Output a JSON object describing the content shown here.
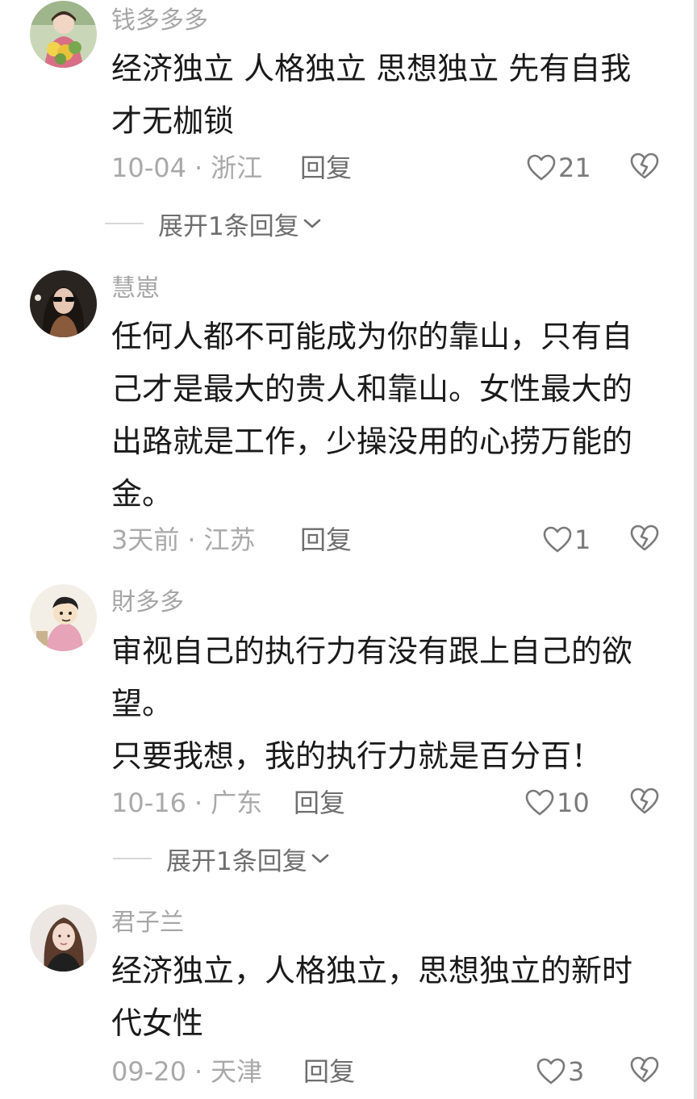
{
  "comments": [
    {
      "username": "钱多多多",
      "avatar_icon": "avatar-woman-flowers",
      "lines": [
        "经济独立 人格独立 思想独立 先有自我",
        "才无枷锁"
      ],
      "date": "10-04",
      "location": "浙江",
      "reply_label": "回复",
      "likes": "21",
      "expand_label": "展开1条回复"
    },
    {
      "username": "慧崽",
      "avatar_icon": "avatar-woman-sunglasses",
      "lines": [
        "任何人都不可能成为你的靠山，只有自",
        "己才是最大的贵人和靠山。女性最大的",
        "出路就是工作，少操没用的心捞万能的",
        "金。"
      ],
      "date": "3天前",
      "location": "江苏",
      "reply_label": "回复",
      "likes": "1"
    },
    {
      "username": "財多多",
      "avatar_icon": "avatar-cartoon-character",
      "lines": [
        "审视自己的执行力有没有跟上自己的欲",
        "望。",
        "只要我想，我的执行力就是百分百！"
      ],
      "date": "10-16",
      "location": "广东",
      "reply_label": "回复",
      "likes": "10",
      "expand_label": "展开1条回复"
    },
    {
      "username": "君子兰",
      "avatar_icon": "avatar-woman-portrait",
      "lines": [
        "经济独立，人格独立，思想独立的新时",
        "代女性"
      ],
      "date": "09-20",
      "location": "天津",
      "reply_label": "回复",
      "likes": "3"
    }
  ],
  "meta_separator": "·",
  "colors": {
    "text": "#1a1a1a",
    "muted": "#a6a6a6",
    "action": "#6e6e6e"
  }
}
